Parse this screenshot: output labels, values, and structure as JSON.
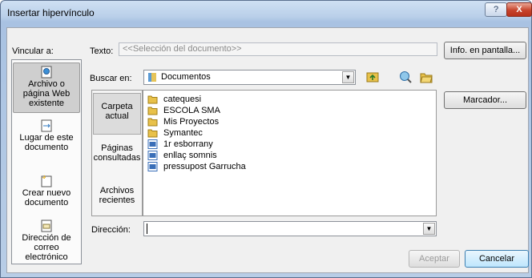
{
  "window": {
    "title": "Insertar hipervínculo",
    "help_label": "?",
    "close_label": "X"
  },
  "link_to": {
    "label": "Vincular a:",
    "items": [
      {
        "line1": "Archivo o",
        "line2": "página Web",
        "line3": "existente",
        "selected": true
      },
      {
        "line1": "Lugar de este",
        "line2": "documento",
        "line3": "",
        "selected": false
      },
      {
        "line1": "Crear nuevo",
        "line2": "documento",
        "line3": "",
        "selected": false
      },
      {
        "line1": "Dirección de",
        "line2": "correo",
        "line3": "electrónico",
        "selected": false
      }
    ]
  },
  "text_field": {
    "label": "Texto:",
    "value": "<<Selección del documento>>"
  },
  "screen_tip_button": "Info. en pantalla...",
  "look_in": {
    "label": "Buscar en:",
    "value": "Documentos"
  },
  "bookmark_button": "Marcador...",
  "places": [
    {
      "line1": "Carpeta",
      "line2": "actual",
      "selected": true
    },
    {
      "line1": "Páginas",
      "line2": "consultadas",
      "selected": false
    },
    {
      "line1": "Archivos",
      "line2": "recientes",
      "selected": false
    }
  ],
  "files": [
    {
      "name": "catequesi",
      "type": "folder"
    },
    {
      "name": "ESCOLA SMA",
      "type": "folder"
    },
    {
      "name": "Mis Proyectos",
      "type": "folder"
    },
    {
      "name": "Symantec",
      "type": "folder"
    },
    {
      "name": "1r esborrany",
      "type": "doc"
    },
    {
      "name": "enllaç somnis",
      "type": "doc"
    },
    {
      "name": "pressupost Garrucha",
      "type": "doc"
    }
  ],
  "address": {
    "label": "Dirección:",
    "value": ""
  },
  "ok_button": "Aceptar",
  "cancel_button": "Cancelar",
  "colors": {
    "folder": "#e8c14a",
    "doc": "#3a6fb8",
    "close": "#c7442c"
  }
}
